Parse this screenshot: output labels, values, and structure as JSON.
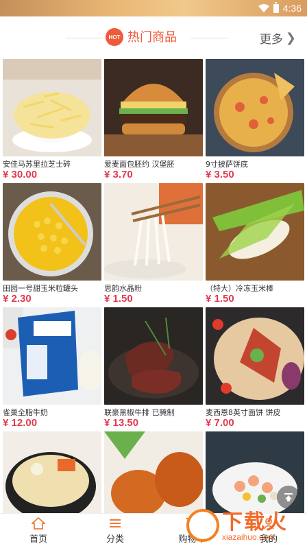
{
  "status_bar": {
    "time": "4:36"
  },
  "section": {
    "badge": "HOT",
    "title": "热门商品",
    "more": "更多",
    "more_chevron": "❯"
  },
  "products": [
    {
      "name": "安佳马苏里拉芝士碎",
      "price": "¥ 30.00",
      "image": "shredded-cheese"
    },
    {
      "name": "爱麦面包胚约 汉堡胚",
      "price": "¥ 3.70",
      "image": "burger"
    },
    {
      "name": "9寸披萨饼底",
      "price": "¥ 3.50",
      "image": "pizza"
    },
    {
      "name": "田园一号甜玉米粒罐头",
      "price": "¥ 2.30",
      "image": "sweet-corn"
    },
    {
      "name": "思韵水晶粉",
      "price": "¥ 1.50",
      "image": "crystal-noodles"
    },
    {
      "name": "（特大）冷冻玉米棒",
      "price": "¥ 1.50",
      "image": "corn-cob"
    },
    {
      "name": "雀巢全脂牛奶",
      "price": "¥ 12.00",
      "image": "milk-box"
    },
    {
      "name": "联豪黑椒牛排 已腌制",
      "price": "¥ 13.50",
      "image": "steak"
    },
    {
      "name": "麦西恩8英寸面饼 饼皮",
      "price": "¥ 7.00",
      "image": "wrap"
    },
    {
      "name": "",
      "price": "",
      "image": "noodle-bowl"
    },
    {
      "name": "",
      "price": "",
      "image": "roast-chicken"
    },
    {
      "name": "",
      "price": "",
      "image": "salad"
    }
  ],
  "tabbar": {
    "items": [
      {
        "label": "首页",
        "icon": "home-icon"
      },
      {
        "label": "分类",
        "icon": "list-icon"
      },
      {
        "label": "购物车",
        "icon": "cart-icon"
      },
      {
        "label": "我的",
        "icon": "user-icon"
      }
    ]
  },
  "watermark": {
    "text": "下载火",
    "url": "xiazaihuo.com"
  },
  "colors": {
    "accent": "#f05a3a",
    "price": "#e23a4e",
    "tab_icon": "#f07c3a"
  }
}
